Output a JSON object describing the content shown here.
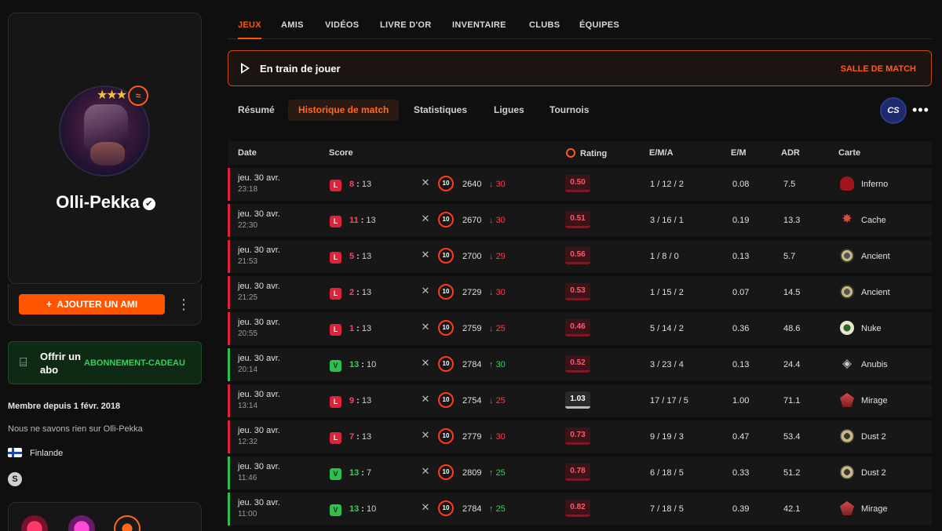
{
  "profile": {
    "username": "Olli-Pekka",
    "stars": "★★★",
    "add_friend": "AJOUTER UN AMI",
    "gift_title": "Offrir un abo",
    "gift_link": "ABONNEMENT-CADEAU",
    "member_since": "Membre depuis 1 févr. 2018",
    "about": "Nous ne savons rien sur Olli-Pekka",
    "country": "Finlande"
  },
  "tabs": [
    "JEUX",
    "AMIS",
    "VIDÉOS",
    "LIVRE D'OR",
    "INVENTAIRE",
    "CLUBS",
    "ÉQUIPES"
  ],
  "playing": {
    "text": "En train de jouer",
    "action": "SALLE DE MATCH"
  },
  "subtabs": [
    "Résumé",
    "Historique de match",
    "Statistiques",
    "Ligues",
    "Tournois"
  ],
  "game_icon": "CS",
  "table": {
    "headers": [
      "Date",
      "Score",
      "Rating",
      "E/M/A",
      "E/M",
      "ADR",
      "Carte"
    ],
    "rows": [
      {
        "date": "jeu. 30 avr.",
        "time": "23:18",
        "result": "L",
        "mine": "8",
        "theirs": "13",
        "level": "10",
        "elo": "2640",
        "delta": "30",
        "trend": "down",
        "rating": "0.50",
        "kda": "1 / 12 / 2",
        "kd": "0.08",
        "adr": "7.5",
        "map": "Inferno",
        "map_icon": "inferno-icon"
      },
      {
        "date": "jeu. 30 avr.",
        "time": "22:30",
        "result": "L",
        "mine": "11",
        "theirs": "13",
        "level": "10",
        "elo": "2670",
        "delta": "30",
        "trend": "down",
        "rating": "0.51",
        "kda": "3 / 16 / 1",
        "kd": "0.19",
        "adr": "13.3",
        "map": "Cache",
        "map_icon": "cache-icon"
      },
      {
        "date": "jeu. 30 avr.",
        "time": "21:53",
        "result": "L",
        "mine": "5",
        "theirs": "13",
        "level": "10",
        "elo": "2700",
        "delta": "29",
        "trend": "down",
        "rating": "0.56",
        "kda": "1 / 8 / 0",
        "kd": "0.13",
        "adr": "5.7",
        "map": "Ancient",
        "map_icon": "ancient-icon"
      },
      {
        "date": "jeu. 30 avr.",
        "time": "21:25",
        "result": "L",
        "mine": "2",
        "theirs": "13",
        "level": "10",
        "elo": "2729",
        "delta": "30",
        "trend": "down",
        "rating": "0.53",
        "kda": "1 / 15 / 2",
        "kd": "0.07",
        "adr": "14.5",
        "map": "Ancient",
        "map_icon": "ancient-icon"
      },
      {
        "date": "jeu. 30 avr.",
        "time": "20:55",
        "result": "L",
        "mine": "1",
        "theirs": "13",
        "level": "10",
        "elo": "2759",
        "delta": "25",
        "trend": "down",
        "rating": "0.46",
        "kda": "5 / 14 / 2",
        "kd": "0.36",
        "adr": "48.6",
        "map": "Nuke",
        "map_icon": "nuke-icon"
      },
      {
        "date": "jeu. 30 avr.",
        "time": "20:14",
        "result": "V",
        "mine": "13",
        "theirs": "10",
        "level": "10",
        "elo": "2784",
        "delta": "30",
        "trend": "up",
        "rating": "0.52",
        "kda": "3 / 23 / 4",
        "kd": "0.13",
        "adr": "24.4",
        "map": "Anubis",
        "map_icon": "anubis-icon"
      },
      {
        "date": "jeu. 30 avr.",
        "time": "13:14",
        "result": "L",
        "mine": "9",
        "theirs": "13",
        "level": "10",
        "elo": "2754",
        "delta": "25",
        "trend": "down",
        "rating": "1.03",
        "kda": "17 / 17 / 5",
        "kd": "1.00",
        "adr": "71.1",
        "map": "Mirage",
        "map_icon": "mirage-icon"
      },
      {
        "date": "jeu. 30 avr.",
        "time": "12:32",
        "result": "L",
        "mine": "7",
        "theirs": "13",
        "level": "10",
        "elo": "2779",
        "delta": "30",
        "trend": "down",
        "rating": "0.73",
        "kda": "9 / 19 / 3",
        "kd": "0.47",
        "adr": "53.4",
        "map": "Dust 2",
        "map_icon": "dust2-icon"
      },
      {
        "date": "jeu. 30 avr.",
        "time": "11:46",
        "result": "V",
        "mine": "13",
        "theirs": "7",
        "level": "10",
        "elo": "2809",
        "delta": "25",
        "trend": "up",
        "rating": "0.78",
        "kda": "6 / 18 / 5",
        "kd": "0.33",
        "adr": "51.2",
        "map": "Dust 2",
        "map_icon": "dust2-icon"
      },
      {
        "date": "jeu. 30 avr.",
        "time": "11:00",
        "result": "V",
        "mine": "13",
        "theirs": "10",
        "level": "10",
        "elo": "2784",
        "delta": "25",
        "trend": "up",
        "rating": "0.82",
        "kda": "7 / 18 / 5",
        "kd": "0.39",
        "adr": "42.1",
        "map": "Mirage",
        "map_icon": "mirage-icon"
      }
    ]
  },
  "colors": {
    "accent": "#ff5500",
    "loss": "#e0213a",
    "win": "#2fbf4e"
  }
}
